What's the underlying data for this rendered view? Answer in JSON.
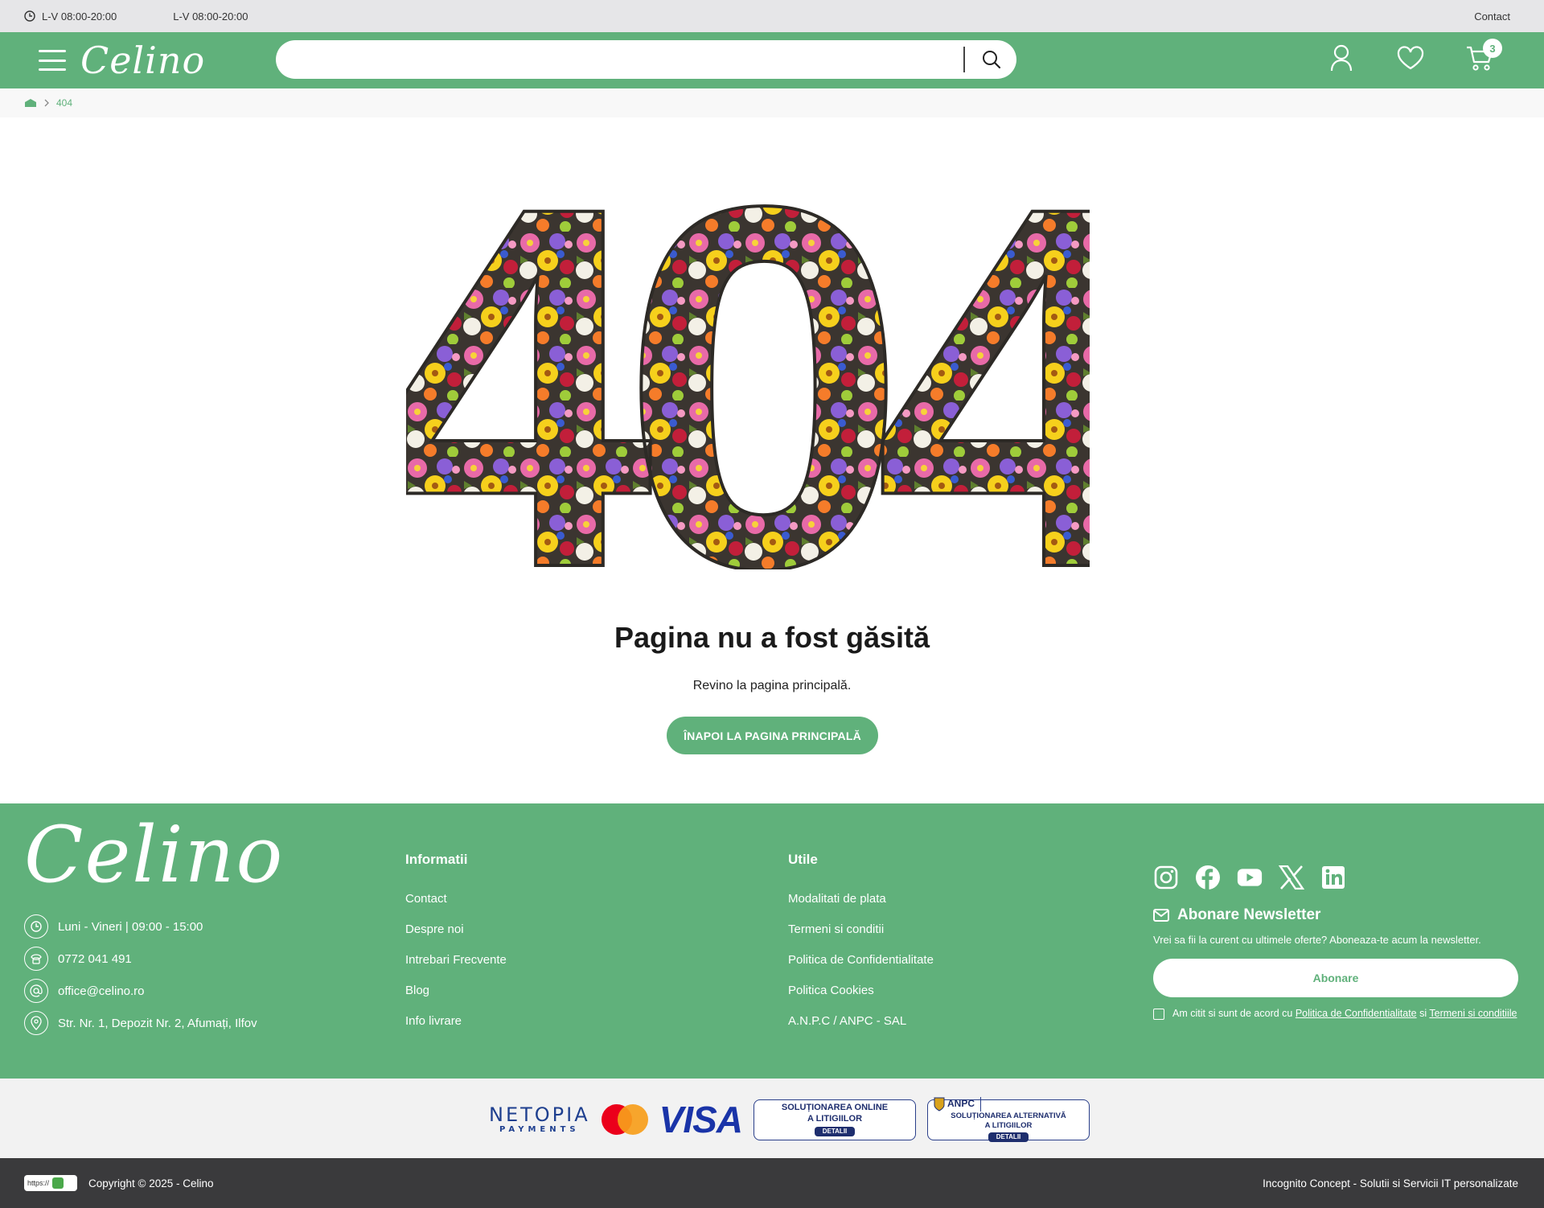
{
  "topbar": {
    "hours_1": "L-V 08:00-20:00",
    "hours_2": "L-V 08:00-20:00",
    "contact": "Contact"
  },
  "header": {
    "logo": "Celino",
    "search_placeholder": "",
    "cart_count": "3"
  },
  "breadcrumb": {
    "current": "404"
  },
  "main": {
    "big_number": "404",
    "title": "Pagina nu a fost găsită",
    "subtitle": "Revino la pagina principală.",
    "button": "ÎNAPOI LA PAGINA PRINCIPALĂ"
  },
  "footer": {
    "logo": "Celino",
    "contact": {
      "hours": "Luni - Vineri  |  09:00 - 15:00",
      "phone": "0772 041 491",
      "email": "office@celino.ro",
      "address": "Str. Nr. 1, Depozit Nr. 2, Afumați, Ilfov"
    },
    "info": {
      "heading": "Informatii",
      "links": [
        "Contact",
        "Despre noi",
        "Intrebari Frecvente",
        "Blog",
        "Info livrare"
      ]
    },
    "utile": {
      "heading": "Utile",
      "links": [
        "Modalitati de plata",
        "Termeni si conditii",
        "Politica de Confidentialitate",
        "Politica Cookies",
        "A.N.P.C  /  ANPC - SAL"
      ]
    },
    "social": [
      "instagram-icon",
      "facebook-icon",
      "youtube-icon",
      "x-icon",
      "linkedin-icon"
    ],
    "newsletter": {
      "heading": "Abonare Newsletter",
      "text": "Vrei sa fii la curent cu ultimele oferte? Aboneaza-te acum la newsletter.",
      "button": "Abonare",
      "agree_prefix": "Am citit si sunt de acord cu ",
      "agree_link_1": "Politica de Confidentialitate",
      "agree_mid": " si ",
      "agree_link_2": "Termeni si conditiile"
    }
  },
  "payments": {
    "netopia": "NETOPIA",
    "netopia_sub": "PAYMENTS",
    "visa": "VISA",
    "sol_online_1": "SOLUȚIONAREA ONLINE",
    "sol_online_2": "A LITIGIILOR",
    "details": "DETALII",
    "anpc": "ANPC",
    "sol_alt_1": "SOLUȚIONAREA ALTERNATIVĂ",
    "sol_alt_2": "A LITIGIILOR"
  },
  "bottom": {
    "ssl": "https://",
    "copyright": "Copyright © 2025 - Celino",
    "credit": "Incognito Concept - Solutii si Servicii IT personalizate"
  },
  "colors": {
    "brand_green": "#60b17b",
    "dark_bar": "#3a3a3c",
    "top_strip": "#e6e6e8"
  }
}
